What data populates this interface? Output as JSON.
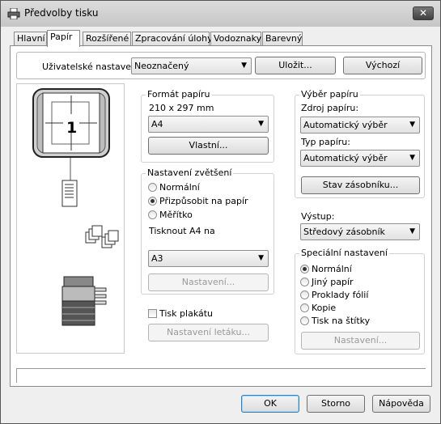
{
  "window": {
    "title": "Předvolby tisku",
    "close_symbol": "✕"
  },
  "tabs": [
    {
      "label": "Hlavní",
      "active": false
    },
    {
      "label": "Papír",
      "active": true
    },
    {
      "label": "Rozšířené",
      "active": false
    },
    {
      "label": "Zpracování úlohy",
      "active": false
    },
    {
      "label": "Vodoznaky",
      "active": false
    },
    {
      "label": "Barevný",
      "active": false
    }
  ],
  "user_settings": {
    "label": "Uživatelské nastavení:",
    "value": "Neoznačený",
    "save_label": "Uložit...",
    "default_label": "Výchozí"
  },
  "preview": {
    "page_number": "1"
  },
  "paper_format": {
    "title": "Formát papíru",
    "size_text": "210 x 297 mm",
    "value": "A4",
    "custom_label": "Vlastní..."
  },
  "zoom": {
    "title": "Nastavení zvětšení",
    "options": [
      {
        "label": "Normální",
        "checked": false
      },
      {
        "label": "Přizpůsobit na papír",
        "checked": true
      },
      {
        "label": "Měřítko",
        "checked": false
      }
    ],
    "print_on_label": "Tisknout A4 na",
    "print_on_value": "A3",
    "settings_label": "Nastavení..."
  },
  "poster": {
    "checkbox_label": "Tisk plakátu",
    "checked": false,
    "leaflet_settings_label": "Nastavení letáku..."
  },
  "paper_select": {
    "title": "Výběr papíru",
    "source_label": "Zdroj papíru:",
    "source_value": "Automatický výběr",
    "type_label": "Typ papíru:",
    "type_value": "Automatický výběr",
    "tray_status_label": "Stav zásobníku..."
  },
  "output": {
    "label": "Výstup:",
    "value": "Středový zásobník"
  },
  "special": {
    "title": "Speciální nastavení",
    "options": [
      {
        "label": "Normální",
        "checked": true
      },
      {
        "label": "Jiný papír",
        "checked": false
      },
      {
        "label": "Proklady fólií",
        "checked": false
      },
      {
        "label": "Kopie",
        "checked": false
      },
      {
        "label": "Tisk na štítky",
        "checked": false
      }
    ],
    "settings_label": "Nastavení..."
  },
  "footer": {
    "ok": "OK",
    "cancel": "Storno",
    "help": "Nápověda"
  },
  "icons": {
    "dropdown": "▼"
  },
  "colors": {
    "accent_default_button": "#3c7fb1"
  }
}
